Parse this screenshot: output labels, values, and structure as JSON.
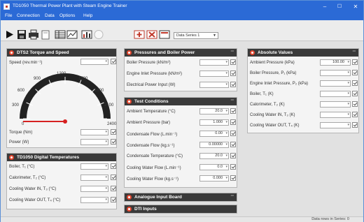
{
  "window": {
    "title": "TD1050 Thermal Power Plant with Steam Engine Trainer",
    "minimize": "–",
    "maximize": "☐",
    "close": "✕"
  },
  "menu": [
    "File",
    "Connection",
    "Data",
    "Options",
    "Help"
  ],
  "toolbar": {
    "series_select": "Data Series 1",
    "icons": [
      "play-icon",
      "save-icon",
      "print-icon",
      "delete-icon",
      "table-icon",
      "chart-icon",
      "graph-icon",
      "circle-icon",
      "add-series-icon",
      "delete-series-icon",
      "series-chart-icon"
    ]
  },
  "panels": {
    "torque_speed": {
      "title": "DTS2 Torque and Speed",
      "speed_label": "Speed (rev.min⁻¹)",
      "gauge_ticks": [
        "0",
        "300",
        "600",
        "900",
        "1200",
        "1500",
        "1800",
        "2100",
        "2400"
      ],
      "gauge_value": 0,
      "rows": [
        {
          "label": "Torque (Nm)",
          "value": ""
        },
        {
          "label": "Power (W)",
          "value": ""
        }
      ]
    },
    "digital_temps": {
      "title": "TD1050 Digital Temperatures",
      "rows": [
        {
          "label": "Boiler, T₁ (°C)",
          "value": ""
        },
        {
          "label": "Calorimeter, T₂ (°C)",
          "value": ""
        },
        {
          "label": "Cooling Water IN, T₃ (°C)",
          "value": ""
        },
        {
          "label": "Cooling Water OUT, T₄ (°C)",
          "value": ""
        }
      ]
    },
    "pressures": {
      "title": "Pressures and Boiler Power",
      "rows": [
        {
          "label": "Boiler Pressure (kN/m²)",
          "value": ""
        },
        {
          "label": "Engine Inlet Pressure (kN/m²)",
          "value": ""
        },
        {
          "label": "Electrical Power Input (W)",
          "value": ""
        }
      ]
    },
    "test_conditions": {
      "title": "Test Conditions",
      "rows": [
        {
          "label": "Ambient Temperature (°C)",
          "value": "20.0"
        },
        {
          "label": "Ambient Pressure (bar)",
          "value": "1.000"
        },
        {
          "label": "Condensate Flow (L.min⁻¹)",
          "value": "0.00"
        },
        {
          "label": "Condensate Flow (kg.s⁻¹)",
          "value": "0.00000"
        },
        {
          "label": "Condensate Temperature (°C)",
          "value": "20.0"
        },
        {
          "label": "Cooling Water Flow (L.min⁻¹)",
          "value": "0.0"
        },
        {
          "label": "Cooling Water Flow (kg.s⁻¹)",
          "value": "0.000"
        }
      ]
    },
    "analogue": {
      "title": "Analogue Input Board"
    },
    "dti": {
      "title": "DTI Inputs"
    },
    "absolute": {
      "title": "Absolute Values",
      "rows": [
        {
          "label": "Ambient Pressure (kPa)",
          "value": "100.00"
        },
        {
          "label": "Boiler Pressure, P₁ (kPa)",
          "value": ""
        },
        {
          "label": "Engine Inlet Pressure, P₂ (kPa)",
          "value": ""
        },
        {
          "label": "Boiler, T₁ (K)",
          "value": ""
        },
        {
          "label": "Calorimeter, T₂ (K)",
          "value": ""
        },
        {
          "label": "Cooling Water IN, T₃ (K)",
          "value": ""
        },
        {
          "label": "Cooling Water OUT, T₄ (K)",
          "value": ""
        }
      ]
    }
  },
  "status": "Data rows in Series: 0",
  "colors": {
    "title_bar": "#2b6ad6",
    "panel_header": "#3a3a3a",
    "accent_red": "#e3452d"
  }
}
